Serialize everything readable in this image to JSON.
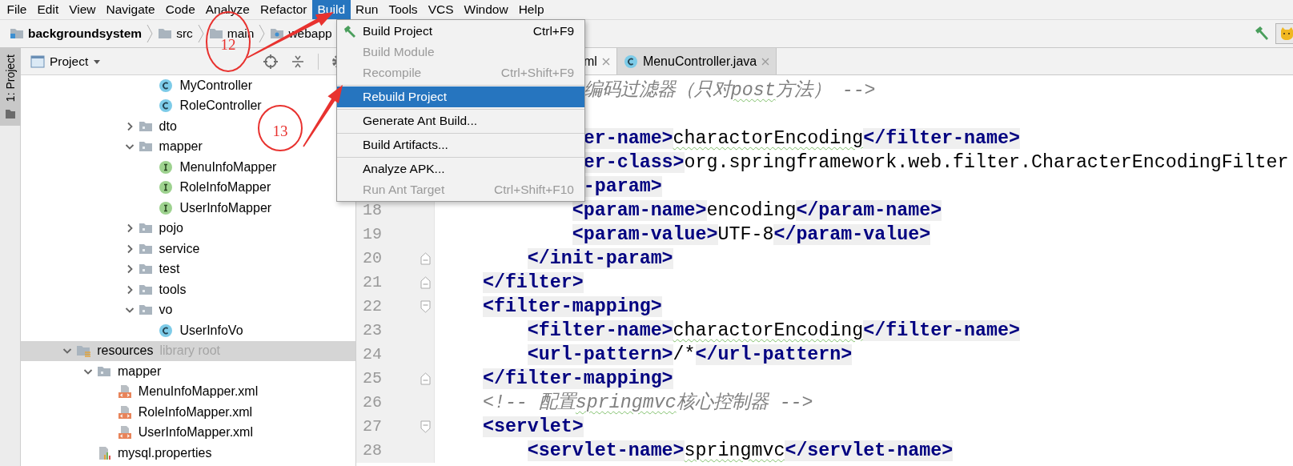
{
  "menu_bar": [
    {
      "label": "File",
      "selected": false
    },
    {
      "label": "Edit",
      "selected": false
    },
    {
      "label": "View",
      "selected": false
    },
    {
      "label": "Navigate",
      "selected": false
    },
    {
      "label": "Code",
      "selected": false
    },
    {
      "label": "Analyze",
      "selected": false
    },
    {
      "label": "Refactor",
      "selected": false
    },
    {
      "label": "Build",
      "selected": true
    },
    {
      "label": "Run",
      "selected": false
    },
    {
      "label": "Tools",
      "selected": false
    },
    {
      "label": "VCS",
      "selected": false
    },
    {
      "label": "Window",
      "selected": false
    },
    {
      "label": "Help",
      "selected": false
    }
  ],
  "breadcrumb": [
    {
      "label": "backgroundsystem",
      "kind": "module"
    },
    {
      "label": "src",
      "kind": "folder"
    },
    {
      "label": "main",
      "kind": "folder"
    },
    {
      "label": "webapp",
      "kind": "web-folder"
    }
  ],
  "build_menu": [
    {
      "kind": "item",
      "label": "Build Project",
      "shortcut": "Ctrl+F9",
      "disabled": false,
      "selected": false,
      "has_icon": true
    },
    {
      "kind": "item",
      "label": "Build Module",
      "disabled": true,
      "selected": false,
      "has_icon": false
    },
    {
      "kind": "item",
      "label": "Recompile",
      "shortcut": "Ctrl+Shift+F9",
      "disabled": true,
      "selected": false,
      "has_icon": false
    },
    {
      "kind": "separator"
    },
    {
      "kind": "item",
      "label": "Rebuild Project",
      "disabled": false,
      "selected": true,
      "has_icon": false
    },
    {
      "kind": "separator"
    },
    {
      "kind": "item",
      "label": "Generate Ant Build...",
      "disabled": false,
      "selected": false,
      "has_icon": false
    },
    {
      "kind": "separator"
    },
    {
      "kind": "item",
      "label": "Build Artifacts...",
      "disabled": false,
      "selected": false,
      "has_icon": false
    },
    {
      "kind": "separator"
    },
    {
      "kind": "item",
      "label": "Analyze APK...",
      "disabled": false,
      "selected": false,
      "has_icon": false
    },
    {
      "kind": "item",
      "label": "Run Ant Target",
      "shortcut": "Ctrl+Shift+F10",
      "disabled": true,
      "selected": false,
      "has_icon": false
    }
  ],
  "tool_window_stripe": [
    {
      "label": "1: Project",
      "selected": true
    }
  ],
  "project_panel": {
    "title": "Project",
    "tree": [
      {
        "children": [
          {
            "children": [
              {
                "children": [
                  {
                    "children": [
                      {
                        "label": "MyController",
                        "kind": "class",
                        "selected": false
                      },
                      {
                        "label": "RoleController",
                        "kind": "class",
                        "selected": false
                      }
                    ]
                  },
                  {
                    "label": "dto",
                    "kind": "package",
                    "expanded": false,
                    "selected": false
                  },
                  {
                    "label": "mapper",
                    "kind": "package",
                    "expanded": true,
                    "selected": false,
                    "children": [
                      {
                        "label": "MenuInfoMapper",
                        "kind": "interface",
                        "selected": false
                      },
                      {
                        "label": "RoleInfoMapper",
                        "kind": "interface",
                        "selected": false
                      },
                      {
                        "label": "UserInfoMapper",
                        "kind": "interface",
                        "selected": false
                      }
                    ]
                  },
                  {
                    "label": "pojo",
                    "kind": "package",
                    "expanded": false,
                    "selected": false
                  },
                  {
                    "label": "service",
                    "kind": "package",
                    "expanded": false,
                    "selected": false
                  },
                  {
                    "label": "test",
                    "kind": "package",
                    "expanded": false,
                    "selected": false
                  },
                  {
                    "label": "tools",
                    "kind": "package",
                    "expanded": false,
                    "selected": false
                  },
                  {
                    "label": "vo",
                    "kind": "package",
                    "expanded": true,
                    "selected": false,
                    "children": [
                      {
                        "label": "UserInfoVo",
                        "kind": "class",
                        "selected": false
                      }
                    ]
                  }
                ]
              }
            ]
          }
        ]
      },
      {
        "label": "resources",
        "note": "library root",
        "kind": "resource-root",
        "expanded": true,
        "selected": true,
        "children": [
          {
            "label": "mapper",
            "kind": "package",
            "expanded": true,
            "selected": false,
            "children": [
              {
                "label": "MenuInfoMapper.xml",
                "kind": "xml",
                "selected": false
              },
              {
                "label": "RoleInfoMapper.xml",
                "kind": "xml",
                "selected": false
              },
              {
                "label": "UserInfoMapper.xml",
                "kind": "xml",
                "selected": false
              }
            ]
          },
          {
            "label": "mysql.properties",
            "kind": "properties",
            "selected": false
          }
        ]
      }
    ]
  },
  "editor": {
    "tabs": [
      {
        "label": "ml",
        "kind": "plain",
        "selected": true
      },
      {
        "label": "MenuController.java",
        "kind": "class",
        "selected": false
      }
    ],
    "lines": [
      {
        "kind": "code",
        "segments": [
          {
            "kind": "comment",
            "text": "             编码过滤器（只对"
          },
          {
            "kind": "comment",
            "text": "post",
            "typo": true
          },
          {
            "kind": "comment",
            "text": "方法） -->"
          }
        ]
      },
      {
        "kind": "blank"
      },
      {
        "kind": "code",
        "segments": [
          {
            "kind": "tag",
            "text": "             er-name>"
          },
          {
            "kind": "text",
            "text": "charactorEncoding",
            "typo": true
          },
          {
            "kind": "tag",
            "text": "</filter-name>"
          }
        ]
      },
      {
        "kind": "code",
        "segments": [
          {
            "kind": "tag",
            "text": "             er-class>"
          },
          {
            "kind": "text",
            "text": "org.springframework.web.filter.CharacterEncodingFilter"
          }
        ]
      },
      {
        "kind": "code",
        "segments": [
          {
            "kind": "tag",
            "text": "             -param>"
          }
        ]
      },
      {
        "kind": "code",
        "number": "18",
        "segments": [
          {
            "kind": "tag",
            "text": "            <param-name>"
          },
          {
            "kind": "text",
            "text": "encoding"
          },
          {
            "kind": "tag",
            "text": "</param-name>"
          }
        ]
      },
      {
        "kind": "code",
        "number": "19",
        "segments": [
          {
            "kind": "tag",
            "text": "            <param-value>"
          },
          {
            "kind": "text",
            "text": "UTF-8"
          },
          {
            "kind": "tag",
            "text": "</param-value>"
          }
        ]
      },
      {
        "kind": "code",
        "number": "20",
        "fold_marker": {
          "kind": "end"
        },
        "segments": [
          {
            "kind": "tag",
            "text": "        </init-param>"
          }
        ]
      },
      {
        "kind": "code",
        "number": "21",
        "fold_marker": {
          "kind": "end"
        },
        "segments": [
          {
            "kind": "tag",
            "text": "    </filter>"
          }
        ]
      },
      {
        "kind": "code",
        "number": "22",
        "fold_marker": {
          "kind": "start"
        },
        "segments": [
          {
            "kind": "tag",
            "text": "    <filter-mapping>"
          }
        ]
      },
      {
        "kind": "code",
        "number": "23",
        "segments": [
          {
            "kind": "tag",
            "text": "        <filter-name>"
          },
          {
            "kind": "text",
            "text": "charactorEncoding",
            "typo": true
          },
          {
            "kind": "tag",
            "text": "</filter-name>"
          }
        ]
      },
      {
        "kind": "code",
        "number": "24",
        "segments": [
          {
            "kind": "tag",
            "text": "        <url-pattern>"
          },
          {
            "kind": "text",
            "text": "/*"
          },
          {
            "kind": "tag",
            "text": "</url-pattern>"
          }
        ]
      },
      {
        "kind": "code",
        "number": "25",
        "fold_marker": {
          "kind": "end"
        },
        "segments": [
          {
            "kind": "tag",
            "text": "    </filter-mapping>"
          }
        ]
      },
      {
        "kind": "code",
        "number": "26",
        "segments": [
          {
            "kind": "comment",
            "text": "    <!-- 配置"
          },
          {
            "kind": "comment",
            "text": "springmvc",
            "typo": true
          },
          {
            "kind": "comment",
            "text": "核心控制器 -->"
          }
        ]
      },
      {
        "kind": "code",
        "number": "27",
        "fold_marker": {
          "kind": "start"
        },
        "segments": [
          {
            "kind": "tag",
            "text": "    <servlet>"
          }
        ]
      },
      {
        "kind": "code",
        "number": "28",
        "segments": [
          {
            "kind": "tag",
            "text": "        <servlet-name>"
          },
          {
            "kind": "text",
            "text": "springmvc",
            "typo": true
          },
          {
            "kind": "tag",
            "text": "</servlet-name>"
          }
        ]
      }
    ]
  },
  "annotations": [
    {
      "label": "12"
    },
    {
      "label": "13"
    }
  ]
}
